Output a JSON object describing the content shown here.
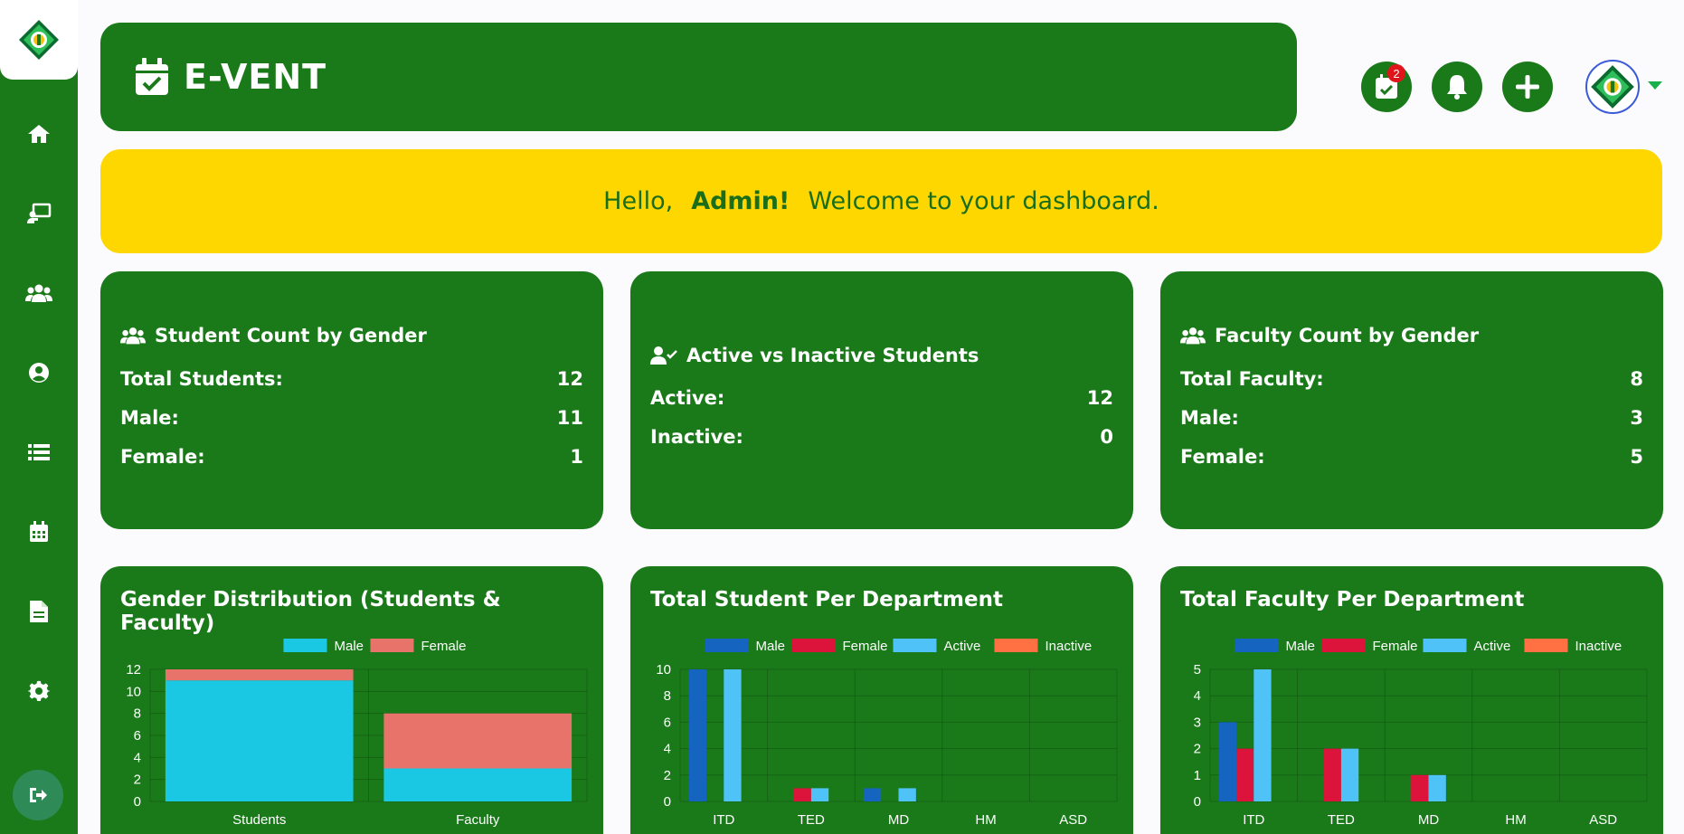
{
  "header": {
    "title": "E-VENT"
  },
  "topbar": {
    "calendar_badge": "2"
  },
  "sidebar": {
    "items": [
      {
        "icon": "home-icon"
      },
      {
        "icon": "teacher-icon"
      },
      {
        "icon": "users-icon"
      },
      {
        "icon": "user-circle-icon"
      },
      {
        "icon": "list-icon"
      },
      {
        "icon": "calendar-icon"
      },
      {
        "icon": "file-icon"
      },
      {
        "icon": "gear-icon"
      }
    ],
    "logout_icon": "logout-icon"
  },
  "welcome": {
    "hello": "Hello,",
    "name": "Admin!",
    "message": "Welcome to your dashboard."
  },
  "stats": {
    "students": {
      "title": "Student Count by Gender",
      "rows": [
        {
          "label": "Total Students:",
          "value": "12"
        },
        {
          "label": "Male:",
          "value": "11"
        },
        {
          "label": "Female:",
          "value": "1"
        }
      ]
    },
    "active": {
      "title": "Active vs Inactive Students",
      "rows": [
        {
          "label": "Active:",
          "value": "12"
        },
        {
          "label": "Inactive:",
          "value": "0"
        }
      ]
    },
    "faculty": {
      "title": "Faculty Count by Gender",
      "rows": [
        {
          "label": "Total Faculty:",
          "value": "8"
        },
        {
          "label": "Male:",
          "value": "3"
        },
        {
          "label": "Female:",
          "value": "5"
        }
      ]
    }
  },
  "colors": {
    "green": "#1a7a1a",
    "yellow": "#ffd700",
    "male_cyan": "#1bc8e4",
    "female_salmon": "#e8736b",
    "male_blue": "#1565c0",
    "female_red": "#dc143c",
    "active_skyblue": "#4fc3f7",
    "inactive_orange": "#ff7043"
  },
  "chart_data": [
    {
      "type": "bar",
      "stacked": true,
      "title": "Gender Distribution (Students & Faculty)",
      "categories": [
        "Students",
        "Faculty"
      ],
      "series": [
        {
          "name": "Male",
          "values": [
            11,
            3
          ],
          "color": "#1bc8e4"
        },
        {
          "name": "Female",
          "values": [
            1,
            5
          ],
          "color": "#e8736b"
        }
      ],
      "ylim": [
        0,
        12
      ],
      "yticks": [
        0,
        2,
        4,
        6,
        8,
        10,
        12
      ],
      "legend": "top"
    },
    {
      "type": "bar",
      "title": "Total Student Per Department",
      "categories": [
        "ITD",
        "TED",
        "MD",
        "HM",
        "ASD"
      ],
      "series": [
        {
          "name": "Male",
          "values": [
            10,
            0,
            1,
            0,
            0
          ],
          "color": "#1565c0"
        },
        {
          "name": "Female",
          "values": [
            0,
            1,
            0,
            0,
            0
          ],
          "color": "#dc143c"
        },
        {
          "name": "Active",
          "values": [
            10,
            1,
            1,
            0,
            0
          ],
          "color": "#4fc3f7"
        },
        {
          "name": "Inactive",
          "values": [
            0,
            0,
            0,
            0,
            0
          ],
          "color": "#ff7043"
        }
      ],
      "ylim": [
        0,
        10
      ],
      "yticks": [
        0,
        2,
        4,
        6,
        8,
        10
      ],
      "legend": "top"
    },
    {
      "type": "bar",
      "title": "Total Faculty Per Department",
      "categories": [
        "ITD",
        "TED",
        "MD",
        "HM",
        "ASD"
      ],
      "series": [
        {
          "name": "Male",
          "values": [
            3,
            0,
            0,
            0,
            0
          ],
          "color": "#1565c0"
        },
        {
          "name": "Female",
          "values": [
            2,
            2,
            1,
            0,
            0
          ],
          "color": "#dc143c"
        },
        {
          "name": "Active",
          "values": [
            5,
            2,
            1,
            0,
            0
          ],
          "color": "#4fc3f7"
        },
        {
          "name": "Inactive",
          "values": [
            0,
            0,
            0,
            0,
            0
          ],
          "color": "#ff7043"
        }
      ],
      "ylim": [
        0,
        5
      ],
      "yticks": [
        0,
        1,
        2,
        3,
        4,
        5
      ],
      "legend": "top"
    }
  ]
}
